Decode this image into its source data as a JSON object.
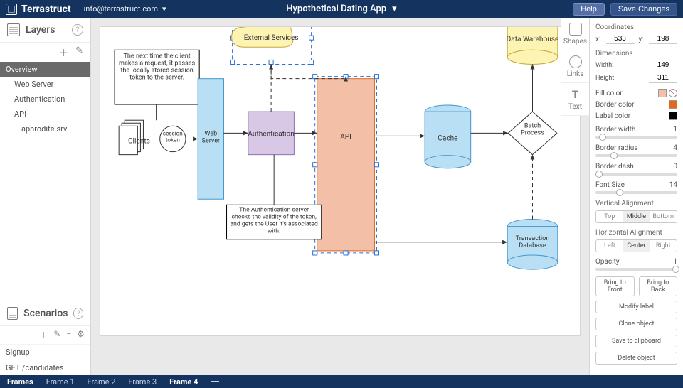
{
  "topbar": {
    "brand": "Terrastruct",
    "email": "info@terrastruct.com",
    "app_title": "Hypothetical Dating App",
    "help": "Help",
    "save": "Save Changes"
  },
  "layers": {
    "title": "Layers",
    "tree": [
      {
        "label": "Overview",
        "depth": 0
      },
      {
        "label": "Web Server",
        "depth": 1
      },
      {
        "label": "Authentication",
        "depth": 1
      },
      {
        "label": "API",
        "depth": 1
      },
      {
        "label": "aphrodite-srv",
        "depth": 2
      }
    ]
  },
  "scenarios": {
    "title": "Scenarios",
    "items": [
      "Signup",
      "GET /candidates"
    ]
  },
  "rail": [
    {
      "label": "Shapes"
    },
    {
      "label": "Links"
    },
    {
      "label": "Text"
    }
  ],
  "diagram": {
    "note1": "The next time the client makes a request, it passes the locally stored session token to the server.",
    "note2": "The Authentication server checks the validity of the token, and gets the User it's associated with.",
    "ext": "External Services",
    "dw": "Data Warehouse",
    "clients": "Clients",
    "sess": "session\ntoken",
    "web": "Web\nServer",
    "auth": "Authentication",
    "api": "API",
    "cache": "Cache",
    "batch": "Batch\nProcess",
    "txdb": "Transaction\nDatabase"
  },
  "props": {
    "coords_title": "Coordinates",
    "x_label": "x:",
    "x": "533",
    "y_label": "y:",
    "y": "198",
    "dim_title": "Dimensions",
    "w_label": "Width:",
    "w": "149",
    "h_label": "Height:",
    "h": "311",
    "fill": "Fill color",
    "fill_swatch": "#f3c0a7",
    "border": "Border color",
    "border_swatch": "#E2681B",
    "labelcolor": "Label color",
    "label_swatch": "#000000",
    "bw_title": "Border width",
    "bw": "1",
    "br_title": "Border radius",
    "br": "4",
    "bd_title": "Border dash",
    "bd": "0",
    "fs_title": "Font Size",
    "fs": "14",
    "va_title": "Vertical Alignment",
    "va": [
      "Top",
      "Middle",
      "Bottom"
    ],
    "ha_title": "Horizontal Alignment",
    "ha": [
      "Left",
      "Center",
      "Right"
    ],
    "op_title": "Opacity",
    "op": "1",
    "bring_front": "Bring to Front",
    "bring_back": "Bring to Back",
    "modify": "Modify label",
    "clone": "Clone object",
    "clip": "Save to clipboard",
    "delete": "Delete object"
  },
  "frames": {
    "label": "Frames",
    "tabs": [
      {
        "label": "Frame 1",
        "active": false
      },
      {
        "label": "Frame 2",
        "active": false
      },
      {
        "label": "Frame 3",
        "active": false
      },
      {
        "label": "Frame 4",
        "active": true
      }
    ]
  }
}
